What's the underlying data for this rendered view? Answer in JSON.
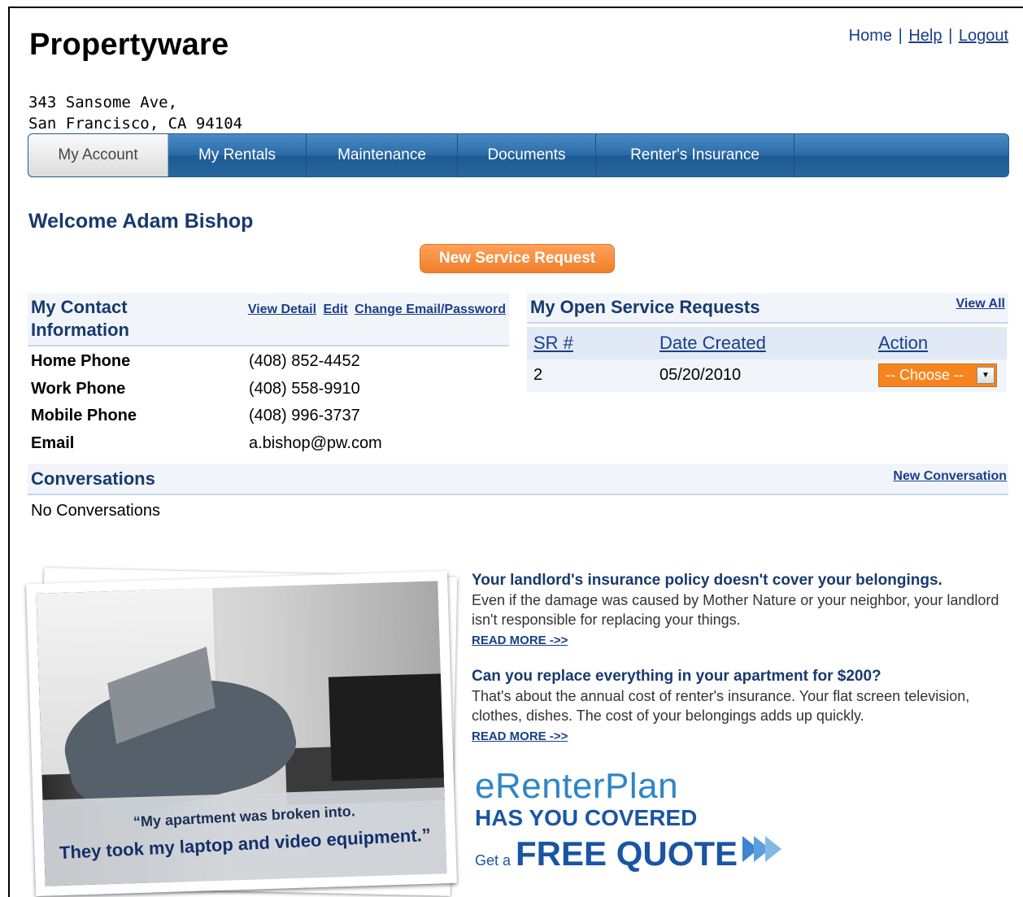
{
  "brand": "Propertyware",
  "top_links": {
    "home": "Home",
    "sep1": "|",
    "help": "Help",
    "sep2": "|",
    "logout": "Logout"
  },
  "address": {
    "line1": "343 Sansome Ave,",
    "line2": "San Francisco, CA 94104"
  },
  "nav": {
    "tabs": [
      {
        "label": "My Account",
        "active": true
      },
      {
        "label": "My Rentals"
      },
      {
        "label": "Maintenance"
      },
      {
        "label": "Documents"
      },
      {
        "label": "Renter's Insurance"
      }
    ]
  },
  "welcome": "Welcome Adam Bishop",
  "new_service_request": "New Service Request",
  "contact": {
    "title": "My Contact Information",
    "links": {
      "view_detail": "View Detail",
      "edit": "Edit",
      "change": "Change Email/Password"
    },
    "rows": [
      {
        "label": "Home Phone",
        "value": "(408) 852-4452"
      },
      {
        "label": "Work Phone",
        "value": "(408) 558-9910"
      },
      {
        "label": "Mobile Phone",
        "value": "(408) 996-3737"
      },
      {
        "label": "Email",
        "value": "a.bishop@pw.com"
      }
    ]
  },
  "service_requests": {
    "title": "My Open Service Requests",
    "view_all": "View All",
    "columns": [
      "SR #",
      "Date Created",
      "Action"
    ],
    "rows": [
      {
        "sr": "2",
        "date": "05/20/2010",
        "action": "-- Choose --"
      }
    ]
  },
  "conversations": {
    "title": "Conversations",
    "new": "New Conversation",
    "empty": "No Conversations"
  },
  "ad": {
    "caption1": "“My apartment was broken into.",
    "caption2": "They took my laptop and video equipment.”",
    "block1_title": "Your landlord's insurance policy doesn't cover your belongings.",
    "block1_text": "Even if the damage was caused by Mother Nature or your neighbor, your landlord isn't responsible for replacing your things.",
    "read_more": "READ MORE ->>",
    "block2_title": "Can you replace everything in your apartment for $200?",
    "block2_text": "That's about the annual cost of renter's insurance. Your flat screen television, clothes, dishes. The cost of your belongings adds up quickly.",
    "logo_line1": "eRenterPlan",
    "logo_line2": "HAS YOU COVERED",
    "logo_get": "Get a",
    "logo_free": "FREE QUOTE"
  }
}
